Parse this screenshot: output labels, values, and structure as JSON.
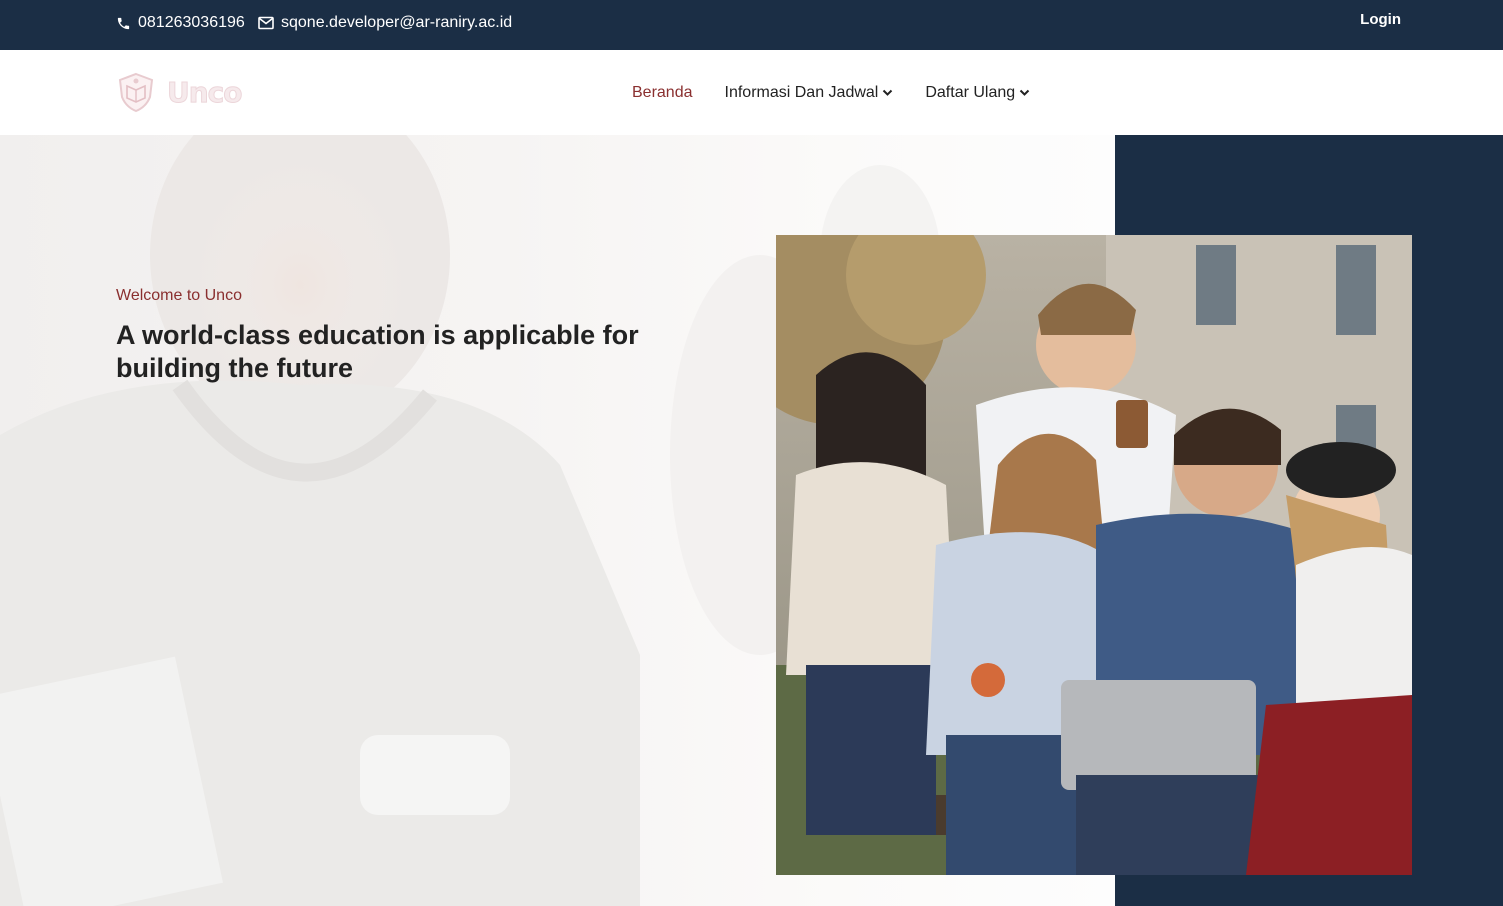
{
  "topbar": {
    "phone": "081263036196",
    "email": "sqone.developer@ar-raniry.ac.id",
    "login_label": "Login"
  },
  "brand": {
    "name": "Unco"
  },
  "nav": {
    "items": [
      {
        "label": "Beranda",
        "active": true
      },
      {
        "label": "Informasi Dan Jadwal",
        "dropdown": true
      },
      {
        "label": "Daftar Ulang",
        "dropdown": true
      }
    ]
  },
  "hero": {
    "welcome": "Welcome to Unco",
    "headline": "A world-class education is applicable for building the future"
  },
  "colors": {
    "navy": "#1b2e45",
    "accent": "#8a2f2f",
    "text": "#222222"
  }
}
